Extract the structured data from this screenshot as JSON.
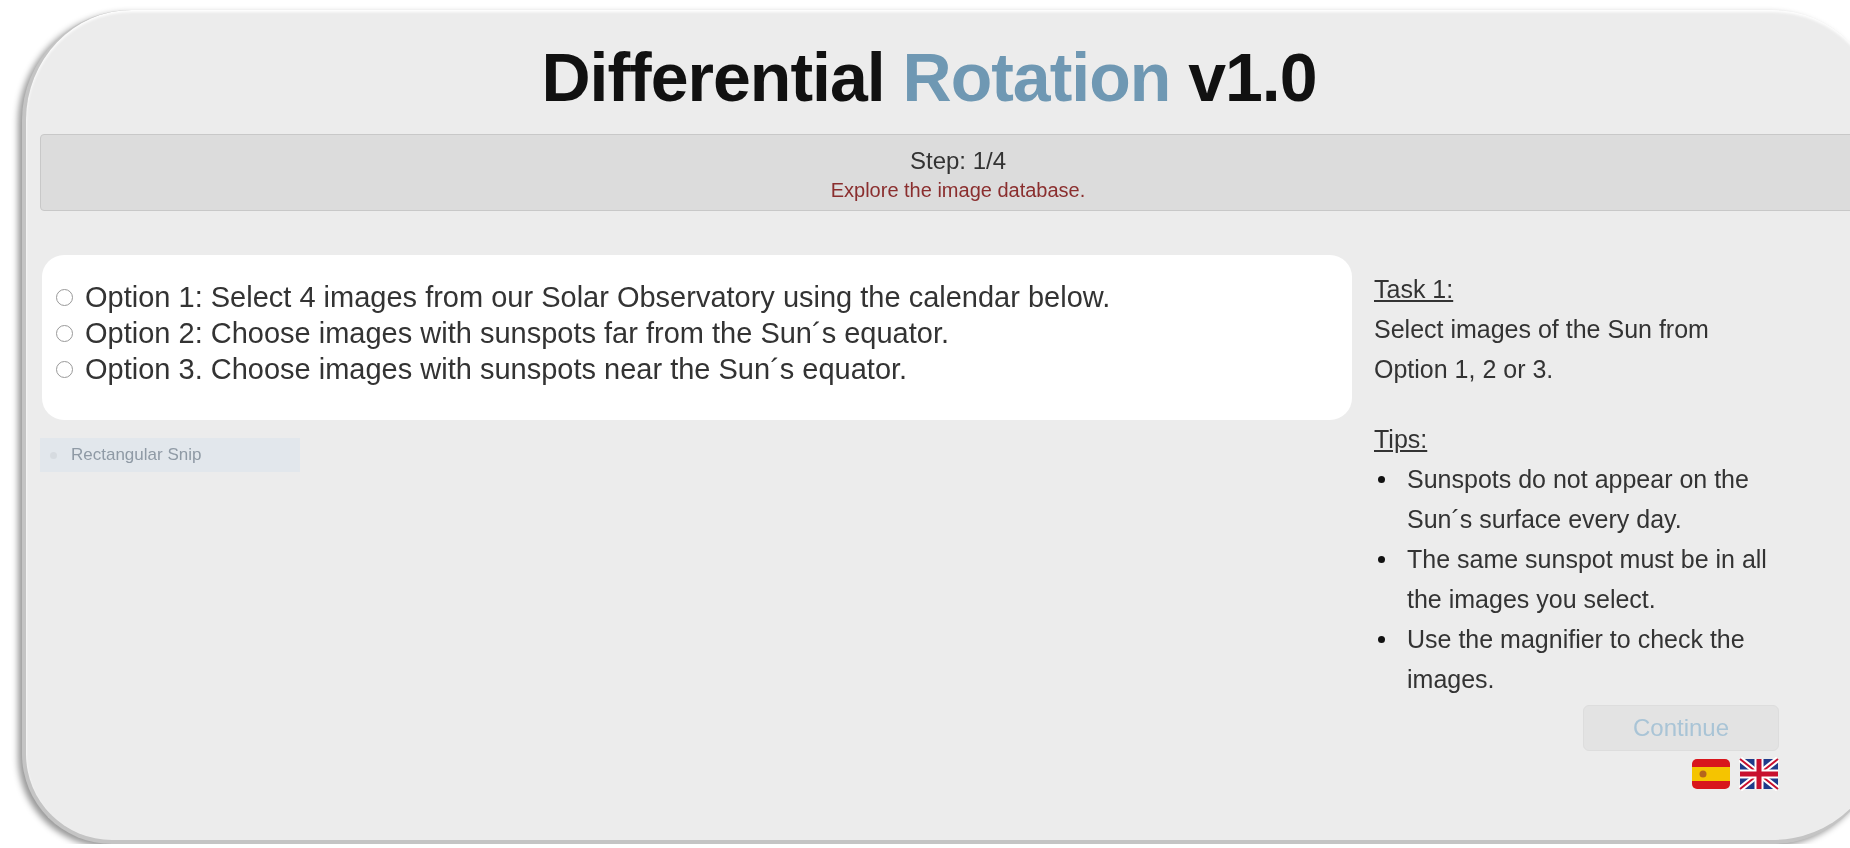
{
  "title": {
    "text_1": "Differential",
    "text_2": "Rotation",
    "text_3": "v1.0"
  },
  "step": {
    "label": "Step: 1/4",
    "instruction": "Explore the image database."
  },
  "options": [
    {
      "label": "Option 1: Select 4 images from our Solar Observatory using the calendar below.",
      "selected": false
    },
    {
      "label": "Option 2: Choose images with sunspots far from the Sun´s equator.",
      "selected": false
    },
    {
      "label": "Option 3. Choose images with sunspots near the Sun´s equator.",
      "selected": false
    }
  ],
  "snip_tooltip": "Rectangular Snip",
  "task": {
    "heading": "Task 1:",
    "text": "Select images of the Sun from Option 1, 2 or 3."
  },
  "tips": {
    "heading": "Tips:",
    "items": [
      "Sunspots do not appear on the Sun´s surface every day.",
      "The same sunspot must be in all the images you select.",
      "Use the magnifier to check the images."
    ]
  },
  "continue_button": {
    "label": "Continue",
    "disabled": true
  },
  "languages": [
    {
      "kind": "spain"
    },
    {
      "kind": "uk"
    }
  ]
}
